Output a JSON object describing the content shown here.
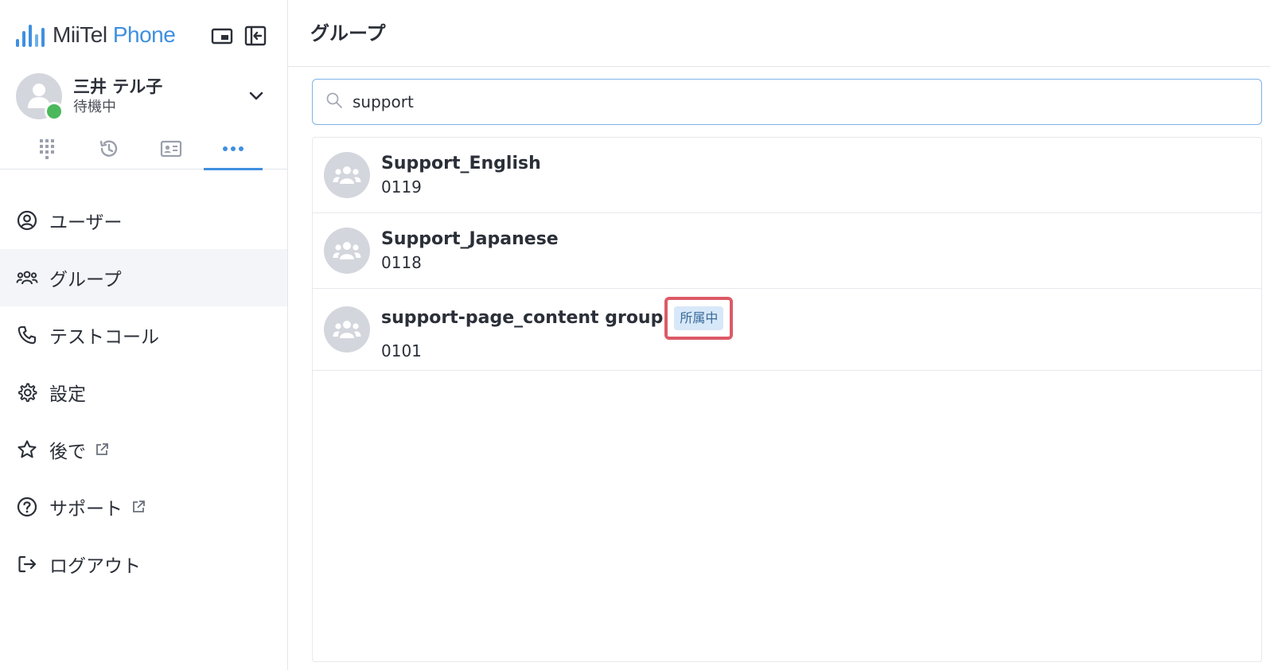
{
  "brand": {
    "name_part1": "MiiTel",
    "name_part2": "Phone",
    "accent_color": "#3f8fe0",
    "icons": [
      "picture-in-picture-icon",
      "collapse-sidebar-icon"
    ]
  },
  "user": {
    "name": "三井 テル子",
    "status": "待機中",
    "status_color": "#4cb85c"
  },
  "tabs": [
    {
      "icon": "dialpad-icon",
      "active": false
    },
    {
      "icon": "history-icon",
      "active": false
    },
    {
      "icon": "contact-card-icon",
      "active": false
    },
    {
      "icon": "more-icon",
      "active": true
    }
  ],
  "menu": {
    "items": [
      {
        "label": "ユーザー",
        "icon": "user-circle-icon"
      },
      {
        "label": "グループ",
        "icon": "group-icon",
        "active": true
      },
      {
        "label": "テストコール",
        "icon": "phone-icon"
      },
      {
        "label": "設定",
        "icon": "gear-icon"
      },
      {
        "label": "後で",
        "icon": "star-icon",
        "external": true
      },
      {
        "label": "サポート",
        "icon": "help-circle-icon",
        "external": true
      },
      {
        "label": "ログアウト",
        "icon": "logout-icon"
      }
    ]
  },
  "header": {
    "title": "グループ"
  },
  "search": {
    "value": "support",
    "icon": "search-icon"
  },
  "groups": [
    {
      "name": "Support_English",
      "number": "0119"
    },
    {
      "name": "Support_Japanese",
      "number": "0118"
    },
    {
      "name": "support-page_content group",
      "number": "0101",
      "badge": "所属中"
    }
  ]
}
